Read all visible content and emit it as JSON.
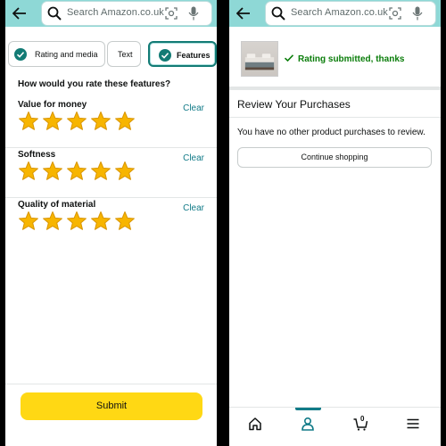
{
  "search": {
    "placeholder": "Search Amazon.co.uk"
  },
  "tabs": [
    {
      "label": "Rating and media",
      "checked": true,
      "active": false
    },
    {
      "label": "Text",
      "checked": false,
      "active": false
    },
    {
      "label": "Features",
      "checked": true,
      "active": true
    }
  ],
  "question": "How would you rate these features?",
  "features": [
    {
      "name": "Value for money",
      "rating": 5,
      "clear": "Clear"
    },
    {
      "name": "Softness",
      "rating": 5,
      "clear": "Clear"
    },
    {
      "name": "Quality of material",
      "rating": 5,
      "clear": "Clear"
    }
  ],
  "submit_label": "Submit",
  "confirmation": "Rating submitted, thanks",
  "review_section": {
    "title": "Review Your Purchases",
    "message": "You have no other product purchases to review.",
    "continue_label": "Continue shopping"
  },
  "nav": {
    "items": [
      "home-icon",
      "account-icon",
      "cart-icon",
      "menu-icon"
    ],
    "active": "account-icon",
    "cart_count": "0"
  },
  "colors": {
    "topbar": "#8ed8d6",
    "accent": "#127b75",
    "star": "#f7b500",
    "submit": "#ffd814",
    "success": "#0a7d0a"
  }
}
